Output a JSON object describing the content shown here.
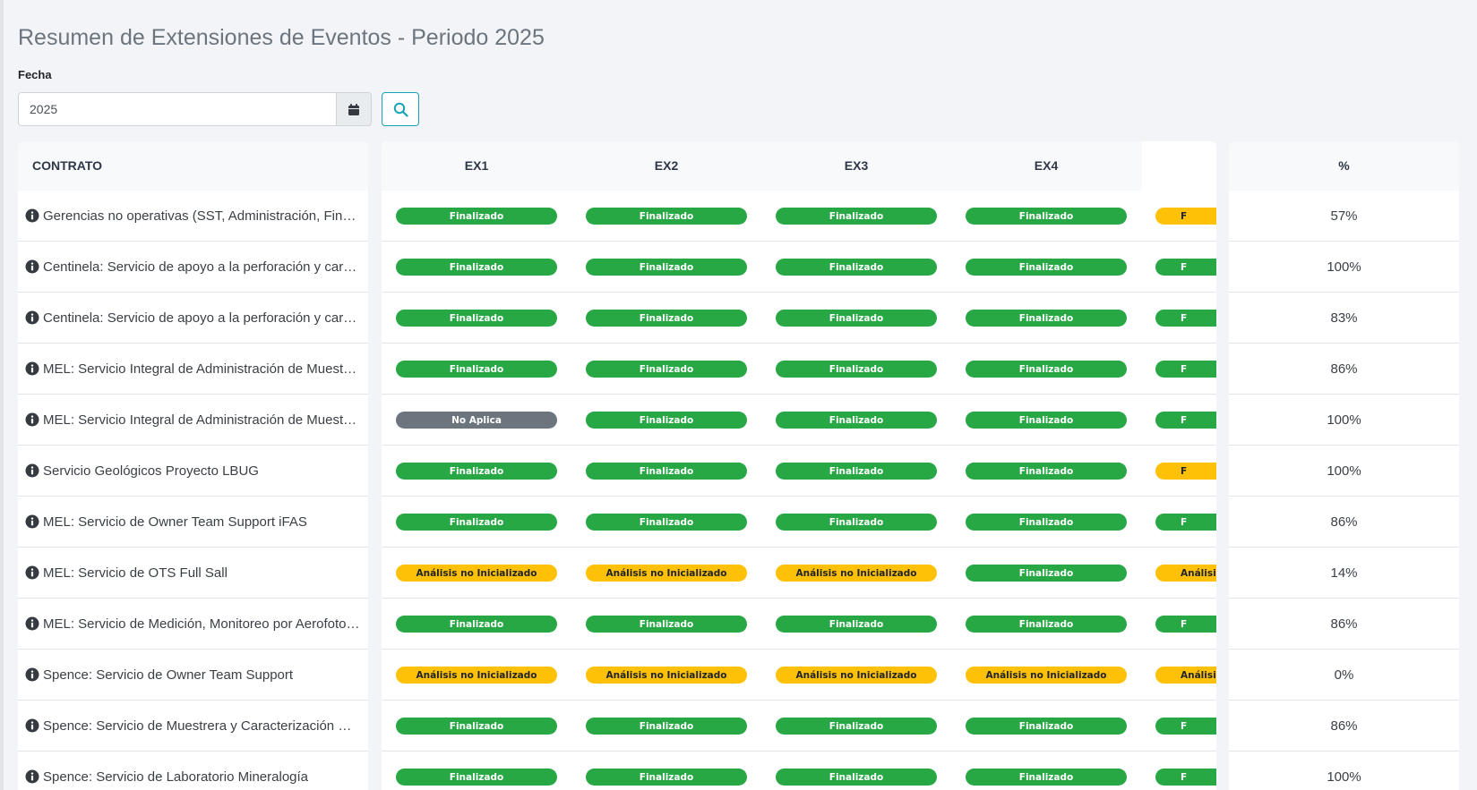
{
  "page": {
    "title": "Resumen de Extensiones de Eventos - Periodo 2025",
    "fecha_label": "Fecha",
    "fecha_value": "2025"
  },
  "icons": {
    "calendar": "calendar-icon",
    "search": "search-icon",
    "info": "info-circle-icon"
  },
  "colors": {
    "finalizado": "#28a745",
    "analisis": "#ffc107",
    "no_aplica": "#6c757d",
    "search_accent": "#17a2b8"
  },
  "table": {
    "headers": {
      "contrato": "CONTRATO",
      "ex": [
        "EX1",
        "EX2",
        "EX3",
        "EX4"
      ],
      "pct": "%"
    },
    "rows": [
      {
        "contrato": "Gerencias no operativas (SST, Administración, Fina…",
        "ex": [
          "Finalizado",
          "Finalizado",
          "Finalizado",
          "Finalizado"
        ],
        "ex5": "F",
        "ex5_status": "analisis",
        "pct": "57%"
      },
      {
        "contrato": "Centinela: Servicio de apoyo a la perforación y cara…",
        "ex": [
          "Finalizado",
          "Finalizado",
          "Finalizado",
          "Finalizado"
        ],
        "ex5": "F",
        "ex5_status": "finalizado",
        "pct": "100%"
      },
      {
        "contrato": "Centinela: Servicio de apoyo a la perforación y cara…",
        "ex": [
          "Finalizado",
          "Finalizado",
          "Finalizado",
          "Finalizado"
        ],
        "ex5": "F",
        "ex5_status": "finalizado",
        "pct": "83%"
      },
      {
        "contrato": "MEL: Servicio Integral de Administración de Muestr…",
        "ex": [
          "Finalizado",
          "Finalizado",
          "Finalizado",
          "Finalizado"
        ],
        "ex5": "F",
        "ex5_status": "finalizado",
        "pct": "86%"
      },
      {
        "contrato": "MEL: Servicio Integral de Administración de Muestr…",
        "ex": [
          "No Aplica",
          "Finalizado",
          "Finalizado",
          "Finalizado"
        ],
        "ex5": "F",
        "ex5_status": "finalizado",
        "pct": "100%"
      },
      {
        "contrato": "Servicio Geológicos Proyecto LBUG",
        "ex": [
          "Finalizado",
          "Finalizado",
          "Finalizado",
          "Finalizado"
        ],
        "ex5": "F",
        "ex5_status": "analisis",
        "pct": "100%"
      },
      {
        "contrato": "MEL: Servicio de Owner Team Support iFAS",
        "ex": [
          "Finalizado",
          "Finalizado",
          "Finalizado",
          "Finalizado"
        ],
        "ex5": "F",
        "ex5_status": "finalizado",
        "pct": "86%"
      },
      {
        "contrato": "MEL: Servicio de OTS Full Sall",
        "ex": [
          "Análisis no Inicializado",
          "Análisis no Inicializado",
          "Análisis no Inicializado",
          "Finalizado"
        ],
        "ex5": "Análisis",
        "ex5_status": "analisis",
        "pct": "14%"
      },
      {
        "contrato": "MEL: Servicio de Medición, Monitoreo por Aerofoto…",
        "ex": [
          "Finalizado",
          "Finalizado",
          "Finalizado",
          "Finalizado"
        ],
        "ex5": "F",
        "ex5_status": "finalizado",
        "pct": "86%"
      },
      {
        "contrato": "Spence: Servicio de Owner Team Support",
        "ex": [
          "Análisis no Inicializado",
          "Análisis no Inicializado",
          "Análisis no Inicializado",
          "Análisis no Inicializado"
        ],
        "ex5": "Análisis",
        "ex5_status": "analisis",
        "pct": "0%"
      },
      {
        "contrato": "Spence: Servicio de Muestrera y Caracterización Ge…",
        "ex": [
          "Finalizado",
          "Finalizado",
          "Finalizado",
          "Finalizado"
        ],
        "ex5": "F",
        "ex5_status": "finalizado",
        "pct": "86%"
      },
      {
        "contrato": "Spence: Servicio de Laboratorio Mineralogía",
        "ex": [
          "Finalizado",
          "Finalizado",
          "Finalizado",
          "Finalizado"
        ],
        "ex5": "F",
        "ex5_status": "finalizado",
        "pct": "100%"
      }
    ]
  }
}
